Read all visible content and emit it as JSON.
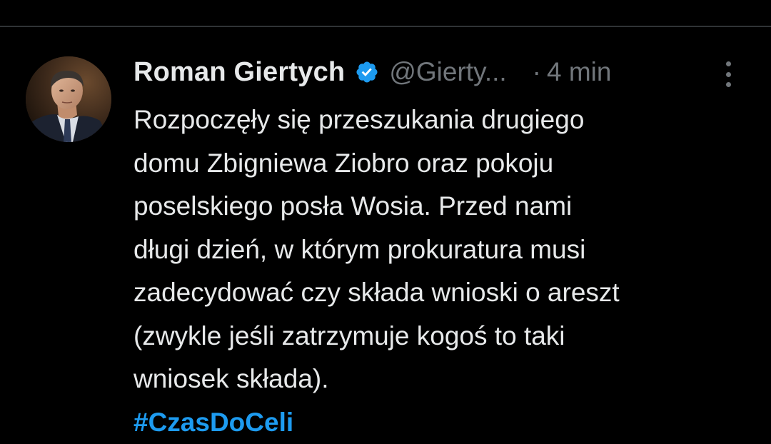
{
  "colors": {
    "background": "#000000",
    "text_primary": "#e7e9ea",
    "text_secondary": "#71767b",
    "accent": "#1d9bf0",
    "divider": "#2f3336"
  },
  "tweet": {
    "author": {
      "display_name": "Roman Giertych",
      "verified_icon": "verified-badge-icon",
      "handle": "@Gierty..."
    },
    "separator": "·",
    "time": "4 min",
    "more_icon": "more-options-icon",
    "text_lines": [
      "Rozpoczęły się przeszukania drugiego",
      "domu Zbigniewa Ziobro oraz pokoju",
      "poselskiego posła Wosia. Przed nami",
      "długi dzień, w którym prokuratura musi",
      "zadecydować czy składa wnioski o areszt",
      "(zwykle jeśli zatrzymuje kogoś to taki",
      "wniosek składa)."
    ],
    "hashtag": "#CzasDoCeli"
  }
}
